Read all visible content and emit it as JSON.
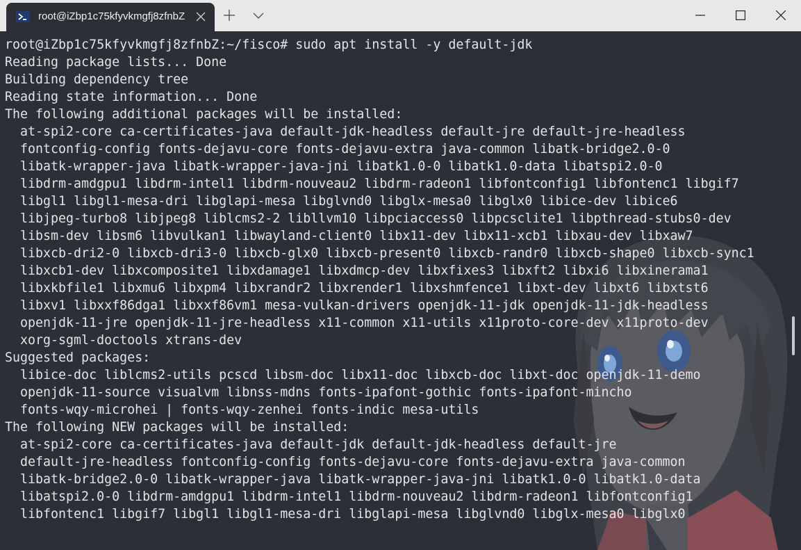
{
  "tab": {
    "title": "root@iZbp1c75kfyvkmgfj8zfnbZ",
    "icon": "powershell-icon"
  },
  "toolbar": {
    "new_tab_icon": "plus-icon",
    "dropdown_icon": "chevron-down-icon"
  },
  "window_controls": [
    "minimize-icon",
    "maximize-icon",
    "close-icon"
  ],
  "terminal": {
    "lines": [
      "root@iZbp1c75kfyvkmgfj8zfnbZ:~/fisco# sudo apt install -y default-jdk",
      "Reading package lists... Done",
      "Building dependency tree",
      "Reading state information... Done",
      "The following additional packages will be installed:",
      "  at-spi2-core ca-certificates-java default-jdk-headless default-jre default-jre-headless",
      "  fontconfig-config fonts-dejavu-core fonts-dejavu-extra java-common libatk-bridge2.0-0",
      "  libatk-wrapper-java libatk-wrapper-java-jni libatk1.0-0 libatk1.0-data libatspi2.0-0",
      "  libdrm-amdgpu1 libdrm-intel1 libdrm-nouveau2 libdrm-radeon1 libfontconfig1 libfontenc1 libgif7",
      "  libgl1 libgl1-mesa-dri libglapi-mesa libglvnd0 libglx-mesa0 libglx0 libice-dev libice6",
      "  libjpeg-turbo8 libjpeg8 liblcms2-2 libllvm10 libpciaccess0 libpcsclite1 libpthread-stubs0-dev",
      "  libsm-dev libsm6 libvulkan1 libwayland-client0 libx11-dev libx11-xcb1 libxau-dev libxaw7",
      "  libxcb-dri2-0 libxcb-dri3-0 libxcb-glx0 libxcb-present0 libxcb-randr0 libxcb-shape0 libxcb-sync1",
      "  libxcb1-dev libxcomposite1 libxdamage1 libxdmcp-dev libxfixes3 libxft2 libxi6 libxinerama1",
      "  libxkbfile1 libxmu6 libxpm4 libxrandr2 libxrender1 libxshmfence1 libxt-dev libxt6 libxtst6",
      "  libxv1 libxxf86dga1 libxxf86vm1 mesa-vulkan-drivers openjdk-11-jdk openjdk-11-jdk-headless",
      "  openjdk-11-jre openjdk-11-jre-headless x11-common x11-utils x11proto-core-dev x11proto-dev",
      "  xorg-sgml-doctools xtrans-dev",
      "Suggested packages:",
      "  libice-doc liblcms2-utils pcscd libsm-doc libx11-doc libxcb-doc libxt-doc openjdk-11-demo",
      "  openjdk-11-source visualvm libnss-mdns fonts-ipafont-gothic fonts-ipafont-mincho",
      "  fonts-wqy-microhei | fonts-wqy-zenhei fonts-indic mesa-utils",
      "The following NEW packages will be installed:",
      "  at-spi2-core ca-certificates-java default-jdk default-jdk-headless default-jre",
      "  default-jre-headless fontconfig-config fonts-dejavu-core fonts-dejavu-extra java-common",
      "  libatk-bridge2.0-0 libatk-wrapper-java libatk-wrapper-java-jni libatk1.0-0 libatk1.0-data",
      "  libatspi2.0-0 libdrm-amdgpu1 libdrm-intel1 libdrm-nouveau2 libdrm-radeon1 libfontconfig1",
      "  libfontenc1 libgif7 libgl1 libgl1-mesa-dri libglapi-mesa libglvnd0 libglx-mesa0 libglx0"
    ]
  },
  "colors": {
    "terminal_bg": "#2b2f37",
    "terminal_fg": "#e4e4e4",
    "titlebar_bg": "#e8e8e8"
  }
}
